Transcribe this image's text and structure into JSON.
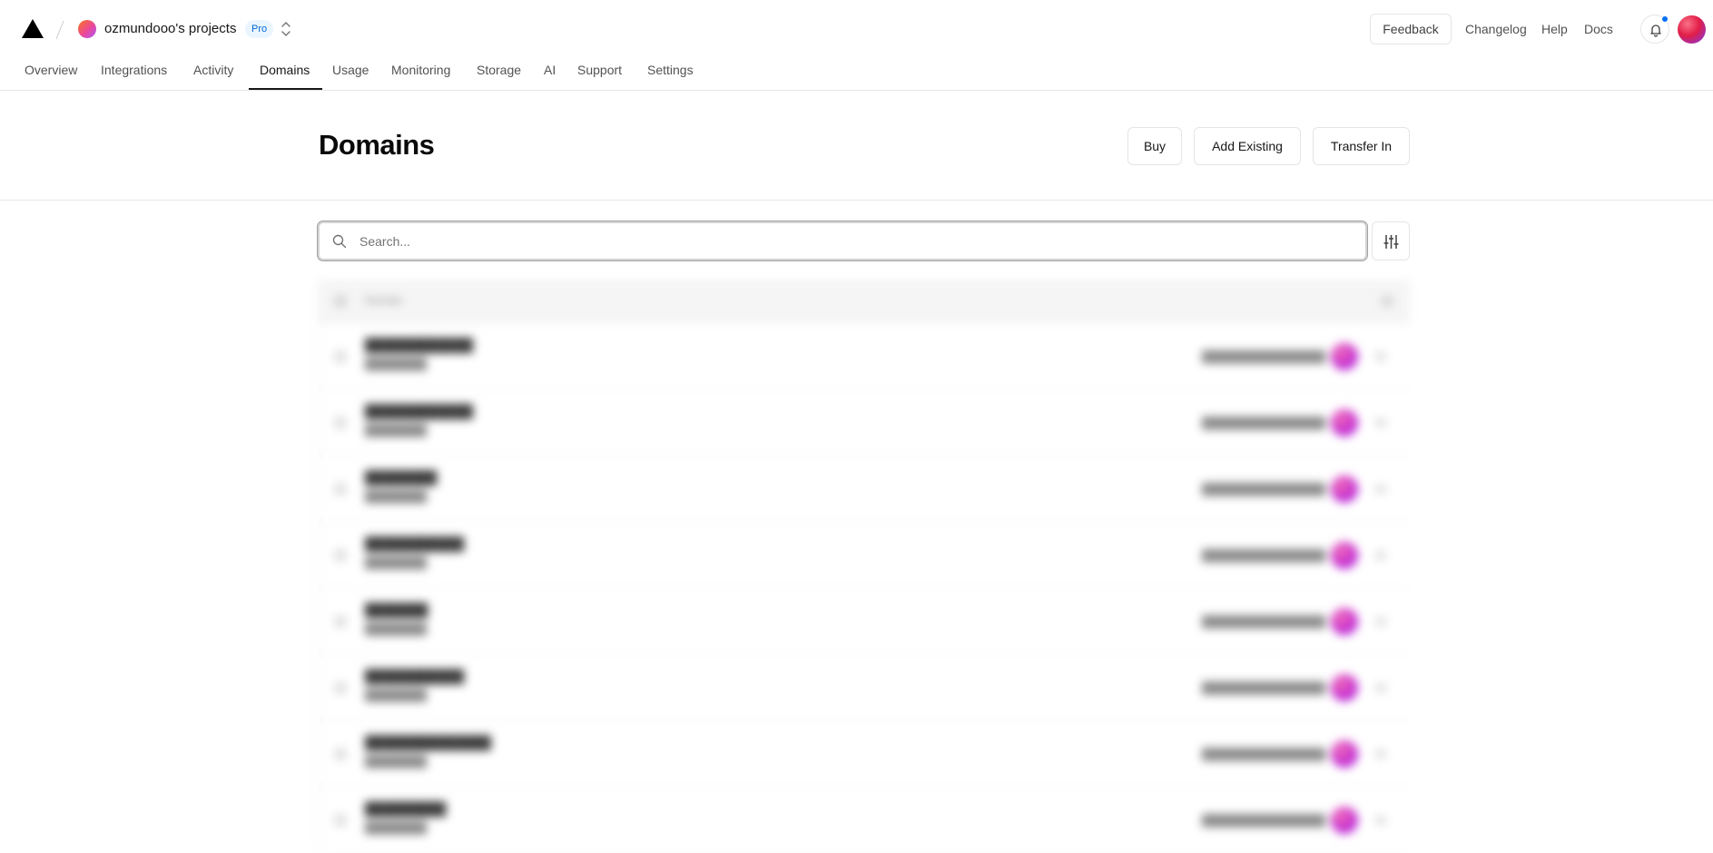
{
  "header": {
    "team_name": "ozmundooo's projects",
    "plan_badge": "Pro",
    "feedback_label": "Feedback",
    "links": [
      "Changelog",
      "Help",
      "Docs"
    ],
    "icons": {
      "logo": "vercel-triangle-icon",
      "switcher": "chevron-up-down-icon",
      "notifications": "bell-icon"
    },
    "notification_dot_color": "#0070f3"
  },
  "tabs": [
    {
      "label": "Overview",
      "active": false
    },
    {
      "label": "Integrations",
      "active": false
    },
    {
      "label": "Activity",
      "active": false
    },
    {
      "label": "Domains",
      "active": true
    },
    {
      "label": "Usage",
      "active": false
    },
    {
      "label": "Monitoring",
      "active": false
    },
    {
      "label": "Storage",
      "active": false
    },
    {
      "label": "AI",
      "active": false
    },
    {
      "label": "Support",
      "active": false
    },
    {
      "label": "Settings",
      "active": false
    }
  ],
  "page": {
    "title": "Domains",
    "actions": [
      "Buy",
      "Add Existing",
      "Transfer In"
    ]
  },
  "search": {
    "placeholder": "Search...",
    "value": ""
  },
  "filter_icon": "sliders-icon",
  "list": {
    "blurred": true,
    "header_label": "Domain",
    "row_count_visible": 8
  }
}
